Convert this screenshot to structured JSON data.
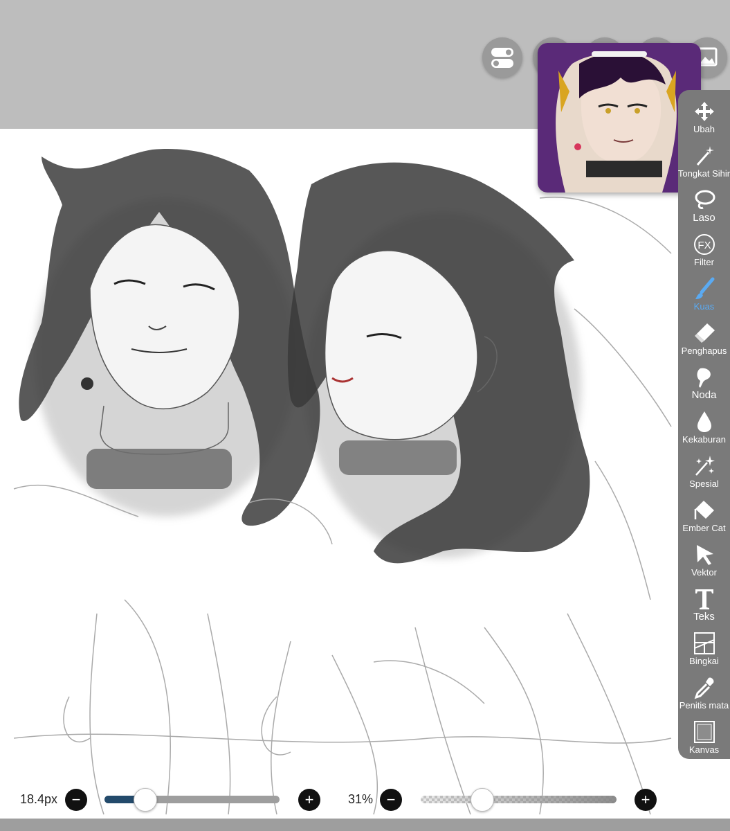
{
  "toolbar_top": {
    "buttons": [
      {
        "name": "settings-toggle",
        "icon": "toggle-switch-icon"
      },
      {
        "name": "undo",
        "icon": "undo-icon"
      },
      {
        "name": "redo",
        "icon": "redo-icon"
      },
      {
        "name": "layer",
        "icon": "layer-icon"
      },
      {
        "name": "reference",
        "icon": "image-icon"
      }
    ]
  },
  "reference_window": {
    "icon": "reference-portrait-icon"
  },
  "tools": [
    {
      "id": "transform",
      "label": "Ubah",
      "icon": "move-arrows-icon",
      "active": false
    },
    {
      "id": "magic-wand",
      "label": "Tongkat Sihir",
      "icon": "magic-wand-icon",
      "active": false
    },
    {
      "id": "lasso",
      "label": "Laso",
      "icon": "lasso-icon",
      "active": false
    },
    {
      "id": "filter",
      "label": "Filter",
      "icon": "fx-icon",
      "active": false
    },
    {
      "id": "brush",
      "label": "Kuas",
      "icon": "brush-icon",
      "active": true
    },
    {
      "id": "eraser",
      "label": "Penghapus",
      "icon": "eraser-icon",
      "active": false
    },
    {
      "id": "smudge",
      "label": "Noda",
      "icon": "smudge-icon",
      "active": false
    },
    {
      "id": "blur",
      "label": "Kekaburan",
      "icon": "droplet-icon",
      "active": false
    },
    {
      "id": "special",
      "label": "Spesial",
      "icon": "sparkle-icon",
      "active": false
    },
    {
      "id": "bucket",
      "label": "Ember Cat",
      "icon": "paint-bucket-icon",
      "active": false
    },
    {
      "id": "vector",
      "label": "Vektor",
      "icon": "cursor-arrow-icon",
      "active": false
    },
    {
      "id": "text",
      "label": "Teks",
      "icon": "text-t-icon",
      "active": false
    },
    {
      "id": "frame",
      "label": "Bingkai",
      "icon": "frame-icon",
      "active": false
    },
    {
      "id": "eyedropper",
      "label": "Penitis mata",
      "icon": "eyedropper-icon",
      "active": false
    },
    {
      "id": "canvas",
      "label": "Kanvas",
      "icon": "canvas-icon",
      "active": false
    }
  ],
  "brush_controls": {
    "size_label": "18.4px",
    "size_fraction": 0.23,
    "opacity_label": "31%",
    "opacity_fraction": 0.31,
    "minus": "−",
    "plus": "+"
  },
  "colors": {
    "top_bar": "#bdbdbd",
    "toolbox": "#7a7a7a",
    "active_tool": "#5aaaf2",
    "slider_fill": "#234a6b"
  }
}
